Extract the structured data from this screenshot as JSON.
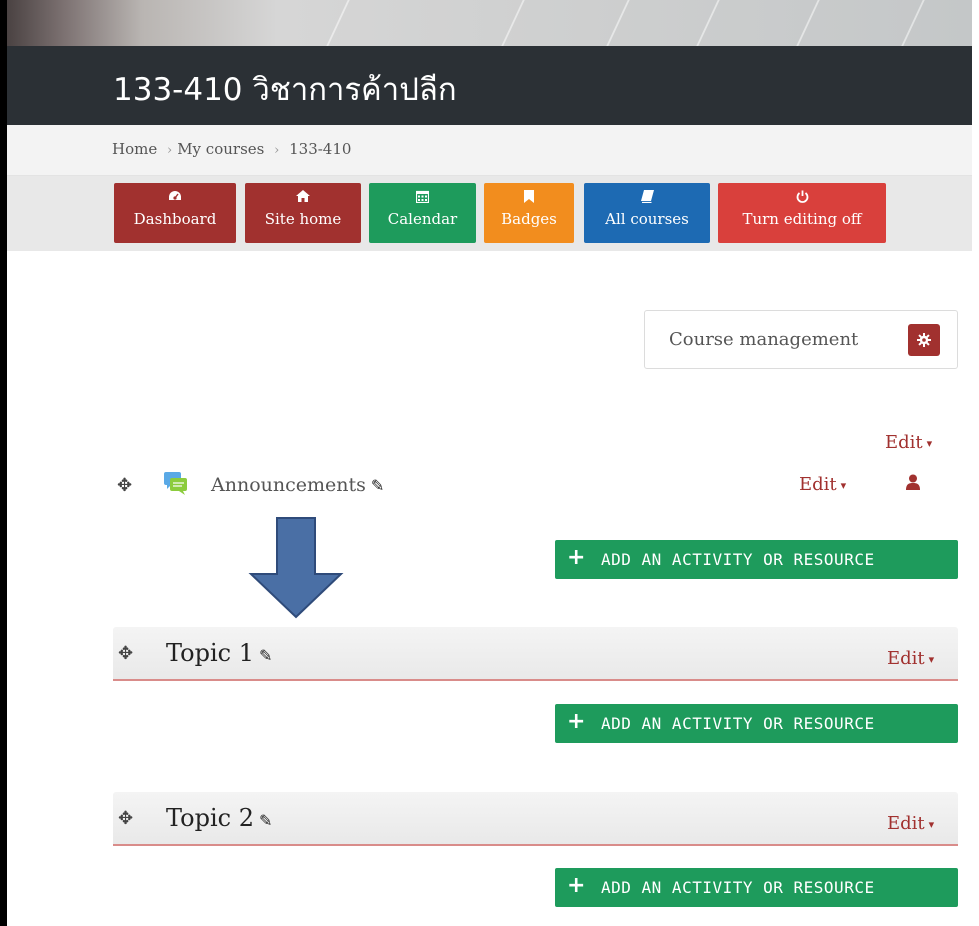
{
  "course": {
    "title": "133-410 วิชาการค้าปลีก"
  },
  "breadcrumb": {
    "items": [
      "Home",
      "My courses",
      "133-410"
    ],
    "separator": "›"
  },
  "nav": {
    "buttons": [
      {
        "label": "Dashboard",
        "icon": "dashboard-icon",
        "color": "#a1312f"
      },
      {
        "label": "Site home",
        "icon": "home-icon",
        "color": "#a1312f"
      },
      {
        "label": "Calendar",
        "icon": "calendar-icon",
        "color": "#1e9b5c"
      },
      {
        "label": "Badges",
        "icon": "bookmark-icon",
        "color": "#f28d1e"
      },
      {
        "label": "All courses",
        "icon": "book-icon",
        "color": "#1d6ab3"
      },
      {
        "label": "Turn editing off",
        "icon": "power-icon",
        "color": "#d9403c"
      }
    ]
  },
  "course_management": {
    "label": "Course management",
    "icon": "gear-icon"
  },
  "edit_label": "Edit",
  "sections": {
    "general": {
      "activity_name": "Announcements",
      "activity_icon": "forum-icon",
      "add_label": "ADD AN ACTIVITY OR RESOURCE"
    },
    "topic1": {
      "title": "Topic 1",
      "add_label": "ADD AN ACTIVITY OR RESOURCE"
    },
    "topic2": {
      "title": "Topic 2",
      "add_label": "ADD AN ACTIVITY OR RESOURCE"
    }
  },
  "colors": {
    "accent": "#a1312f",
    "add_button": "#1e9b5c",
    "annotation_arrow": "#4a6fa5"
  }
}
